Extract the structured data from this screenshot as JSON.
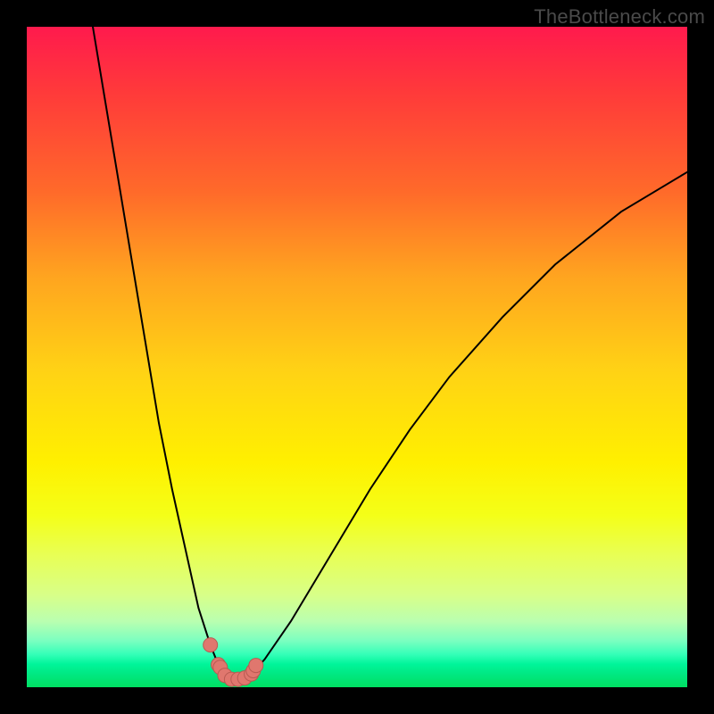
{
  "watermark": "TheBottleneck.com",
  "chart_data": {
    "type": "line",
    "title": "",
    "xlabel": "",
    "ylabel": "",
    "xlim": [
      0,
      100
    ],
    "ylim": [
      0,
      100
    ],
    "series": [
      {
        "name": "bottleneck-curve",
        "x": [
          10,
          12,
          14,
          16,
          18,
          20,
          22,
          24,
          26,
          27.8,
          29,
          30,
          31,
          32,
          33,
          34,
          36,
          40,
          46,
          52,
          58,
          64,
          72,
          80,
          90,
          100
        ],
        "y": [
          100,
          88,
          76,
          64,
          52,
          40,
          30,
          21,
          12,
          6.4,
          3.4,
          1.8,
          1.2,
          1.2,
          1.4,
          2.0,
          4.2,
          10,
          20,
          30,
          39,
          47,
          56,
          64,
          72,
          78
        ]
      }
    ],
    "markers": {
      "name": "highlight-points",
      "x": [
        27.8,
        29.0,
        29.3,
        30.0,
        31.0,
        32.0,
        33.0,
        34.0,
        34.3,
        34.7
      ],
      "y": [
        6.4,
        3.4,
        3.0,
        1.8,
        1.2,
        1.2,
        1.4,
        2.0,
        2.5,
        3.3
      ]
    },
    "background": {
      "type": "vertical-gradient",
      "stops": [
        {
          "pos": 0.0,
          "color": "#ff1a4d"
        },
        {
          "pos": 0.5,
          "color": "#ffd215"
        },
        {
          "pos": 0.74,
          "color": "#f4ff18"
        },
        {
          "pos": 0.95,
          "color": "#35ffb8"
        },
        {
          "pos": 1.0,
          "color": "#00e062"
        }
      ]
    }
  }
}
